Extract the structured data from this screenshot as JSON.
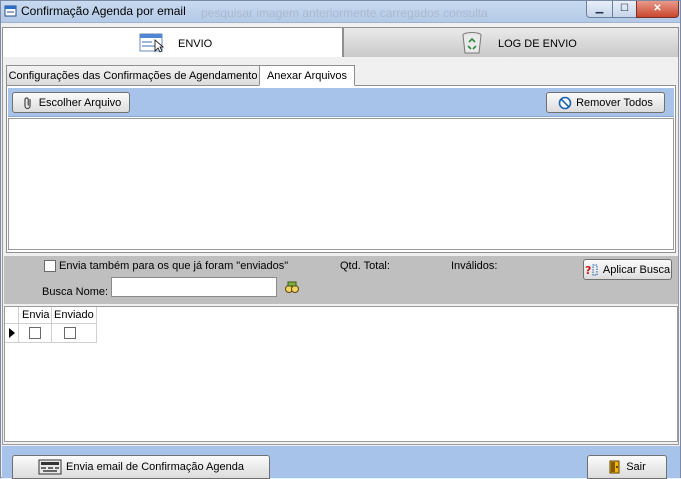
{
  "window": {
    "title": "Confirmação Agenda por email",
    "background_title": "pesquisar imagem anteriormente carregados consulta",
    "controls": {
      "minimize": "▁",
      "maximize": "☐",
      "close": "✕"
    }
  },
  "main_tabs": [
    {
      "label": "ENVIO",
      "icon": "window-cursor-icon",
      "active": true
    },
    {
      "label": "LOG DE ENVIO",
      "icon": "recycle-bin-icon",
      "active": false
    }
  ],
  "sub_tabs": [
    {
      "label": "Configurações das Confirmações de Agendamento",
      "active": false
    },
    {
      "label": "Anexar Arquivos",
      "active": true
    }
  ],
  "attach": {
    "choose_button": "Escolher Arquivo",
    "remove_all_button": "Remover Todos"
  },
  "filters": {
    "also_sent_checkbox": "Envia também para os que já foram \"enviados\"",
    "also_sent_checked": false,
    "qtd_total_label": "Qtd. Total:",
    "invalidos_label": "Inválidos:",
    "apply_button": "Aplicar Busca",
    "search_name_label": "Busca Nome:",
    "search_name_value": ""
  },
  "grid": {
    "columns": [
      "Envia",
      "Enviado"
    ],
    "rows": [
      {
        "envia": false,
        "enviado": false
      }
    ]
  },
  "footer": {
    "send_button": "Envia email de Confirmação Agenda",
    "exit_button": "Sair"
  },
  "colors": {
    "toolbar_blue": "#a7c3ea",
    "filter_gray": "#bfbfbf",
    "close_red": "#c9472f"
  }
}
